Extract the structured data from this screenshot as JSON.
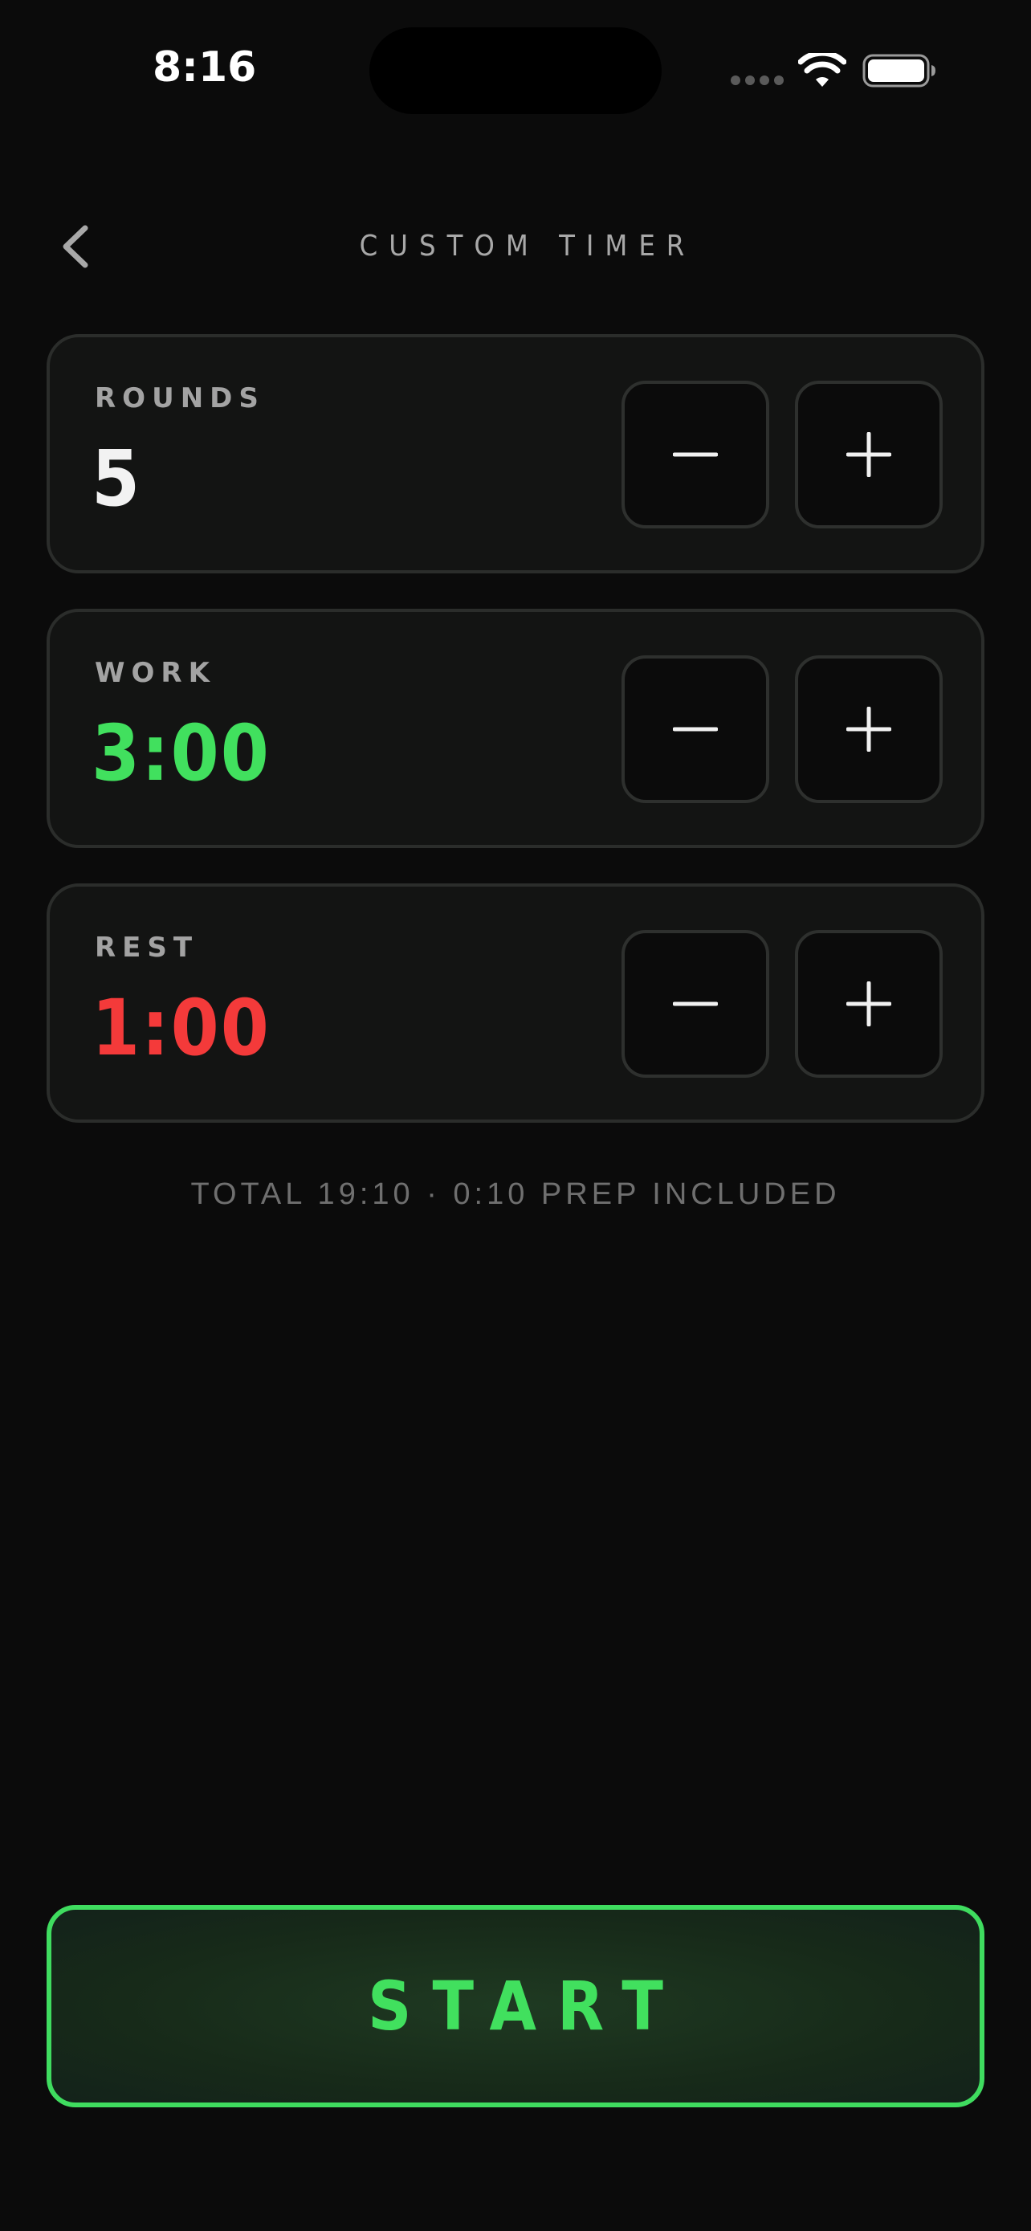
{
  "status_bar": {
    "time": "8:16"
  },
  "header": {
    "back_icon": "chevron-left-icon",
    "title": "CUSTOM TIMER"
  },
  "settings": {
    "rounds": {
      "label": "ROUNDS",
      "value": "5",
      "color": "#f2f2f2"
    },
    "work": {
      "label": "WORK",
      "value": "3:00",
      "color": "#41e05e"
    },
    "rest": {
      "label": "REST",
      "value": "1:00",
      "color": "#f43a3a"
    }
  },
  "stepper_icons": {
    "decrement": "minus-icon",
    "increment": "plus-icon"
  },
  "summary": {
    "total_text": "TOTAL 19:10 · 0:10 PREP INCLUDED"
  },
  "start_button": {
    "label": "START",
    "accent_color": "#41e05e"
  },
  "colors": {
    "background": "#0b0b0b",
    "card": "#131413",
    "accent_green": "#41e05e",
    "accent_red": "#f43a3a"
  }
}
